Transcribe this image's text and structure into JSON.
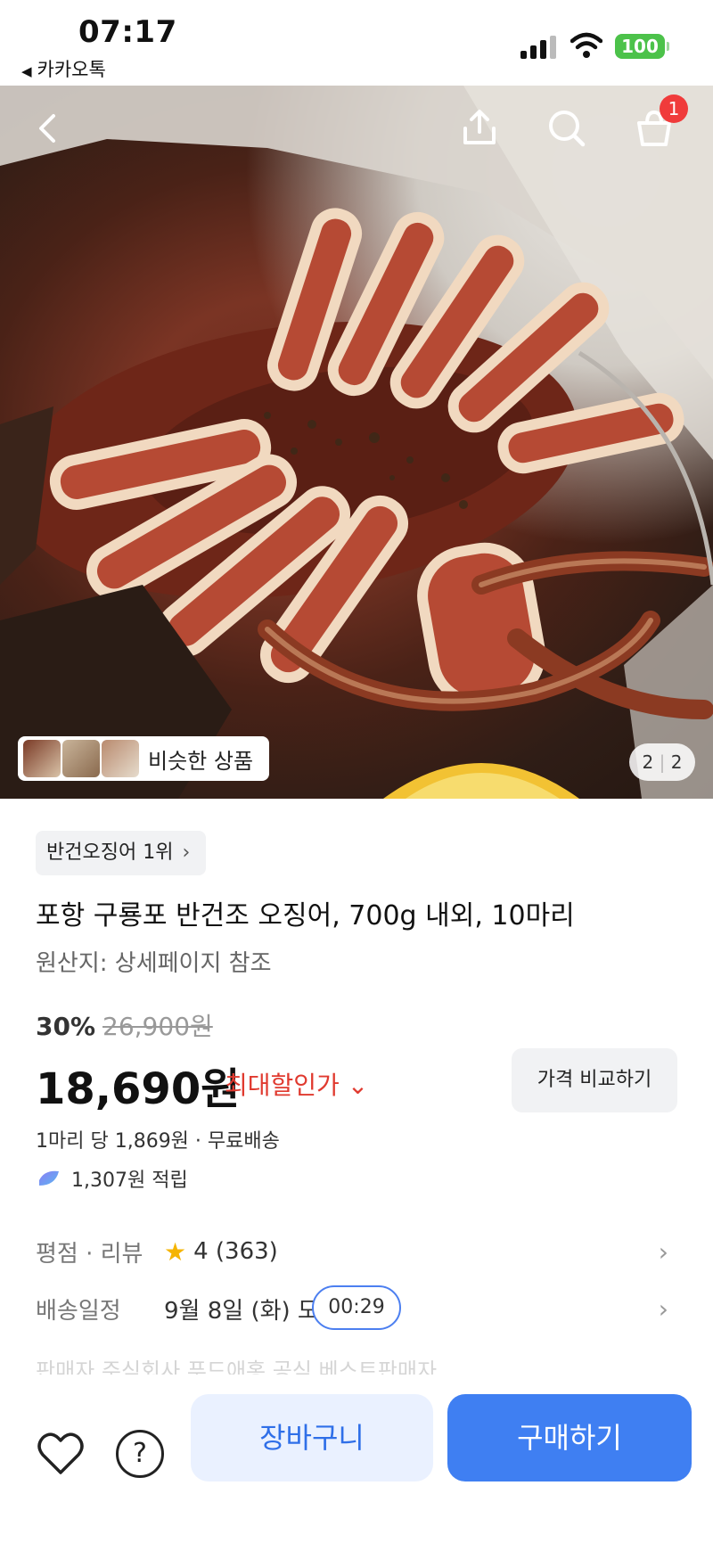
{
  "status_bar": {
    "time": "07:17",
    "back_app": "카카오톡",
    "battery": "100",
    "icons": [
      "signal-icon",
      "wifi-icon",
      "battery-icon"
    ]
  },
  "hero": {
    "nav_icons": [
      "back-icon",
      "share-icon",
      "search-icon",
      "cart-icon"
    ],
    "cart_badge": "1",
    "similar_label": "비슷한 상품",
    "pager_current": "2",
    "pager_separator": "|",
    "pager_total": "2"
  },
  "product": {
    "rank_chip": "반건오징어 1위",
    "rank_chevron": "›",
    "title": "포항 구룡포 반건조 오징어, 700g 내외, 10마리",
    "origin": "원산지: 상세페이지 참조",
    "discount_pct": "30%",
    "original_price": "26,900원",
    "price": "18,690원",
    "max_discount_label": "최대할인가 ⌄",
    "compare_button": "가격 비교하기",
    "unit_price": "1마리 당 1,869원 · 무료배송",
    "points": "1,307원 적립"
  },
  "info_rows": {
    "rating_key": "평점 · 리뷰",
    "rating_value": "4 (363)",
    "shipping_key": "배송일정",
    "shipping_value": "9월 8일 (화) 도",
    "timer": "00:29",
    "seller_faded": "판매자      주식회사 푸드애홍    공식    베스트판매자"
  },
  "bottom_bar": {
    "help_glyph": "?",
    "cart_button": "장바구니",
    "buy_button": "구매하기"
  },
  "colors": {
    "accent_blue": "#3f7ff2",
    "discount_red": "#e03a2f",
    "badge_red": "#f03b3b",
    "battery_green": "#4cc24a",
    "star_yellow": "#f5b400"
  }
}
